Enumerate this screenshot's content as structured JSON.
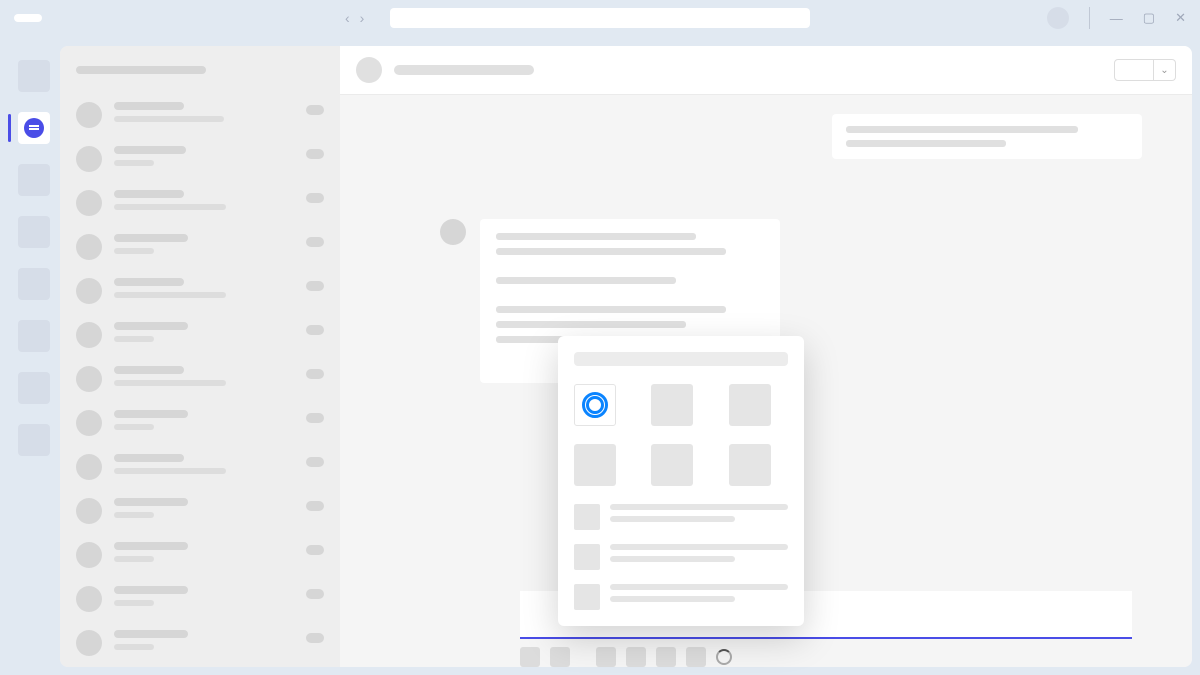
{
  "titlebar": {
    "search_placeholder": "",
    "window_controls": {
      "min": "—",
      "max": "▢",
      "close": "✕"
    },
    "nav": {
      "back": "‹",
      "forward": "›"
    }
  },
  "rail": {
    "items": [
      {
        "name": "activity"
      },
      {
        "name": "chat",
        "active": true
      },
      {
        "name": "teams"
      },
      {
        "name": "calendar"
      },
      {
        "name": "calls"
      },
      {
        "name": "files"
      },
      {
        "name": "apps"
      },
      {
        "name": "more"
      }
    ]
  },
  "chat_list": {
    "header": "",
    "items": [
      {
        "name_w": 70,
        "preview_w": 110
      },
      {
        "name_w": 72,
        "preview_w": 40
      },
      {
        "name_w": 70,
        "preview_w": 112
      },
      {
        "name_w": 74,
        "preview_w": 40
      },
      {
        "name_w": 70,
        "preview_w": 112
      },
      {
        "name_w": 74,
        "preview_w": 40
      },
      {
        "name_w": 70,
        "preview_w": 112
      },
      {
        "name_w": 74,
        "preview_w": 40
      },
      {
        "name_w": 70,
        "preview_w": 112
      },
      {
        "name_w": 74,
        "preview_w": 40
      },
      {
        "name_w": 74,
        "preview_w": 40
      },
      {
        "name_w": 74,
        "preview_w": 40
      },
      {
        "name_w": 74,
        "preview_w": 40
      }
    ]
  },
  "conversation": {
    "header": {
      "title": "",
      "action_label": "",
      "dropdown_label": "⌄"
    },
    "messages": {
      "outgoing": {
        "line_widths": [
          232,
          160
        ]
      },
      "incoming": {
        "line_widths": [
          200,
          230,
          170,
          230,
          190,
          230
        ]
      }
    },
    "compose": {
      "toolbar_count": 6,
      "spinner": true
    }
  },
  "app_picker": {
    "search_placeholder": "",
    "grid": [
      {
        "name": "prezi",
        "highlighted": true
      },
      {
        "name": "app2"
      },
      {
        "name": "app3"
      },
      {
        "name": "app4"
      },
      {
        "name": "app5"
      },
      {
        "name": "app6"
      }
    ],
    "list": [
      {
        "title": "",
        "subtitle": ""
      },
      {
        "title": "",
        "subtitle": ""
      },
      {
        "title": "",
        "subtitle": ""
      }
    ]
  },
  "colors": {
    "accent": "#4a4de7",
    "prezi_blue": "#0a84ff",
    "chrome_bg": "#e1e9f2"
  }
}
